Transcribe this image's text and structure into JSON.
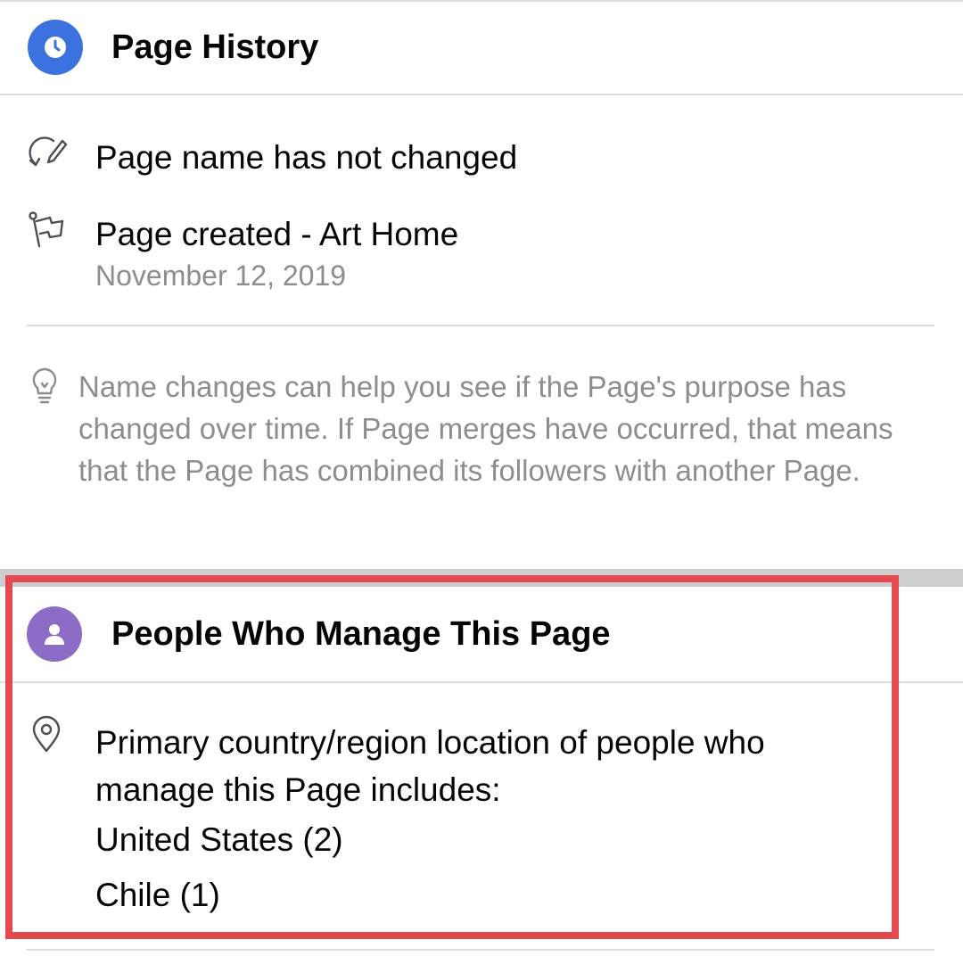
{
  "page_history": {
    "title": "Page History",
    "icon": "clock-icon",
    "icon_color": "#3b72e0",
    "rows": [
      {
        "icon": "edit-history-icon",
        "text": "Page name has not changed"
      },
      {
        "icon": "flag-icon",
        "text": "Page created - Art Home",
        "subtext": "November 12, 2019"
      }
    ],
    "tip": {
      "icon": "lightbulb-icon",
      "text": "Name changes can help you see if the Page's purpose has changed over time. If Page merges have occurred, that means that the Page has combined its followers with another Page."
    }
  },
  "managers": {
    "title": "People Who Manage This Page",
    "icon": "person-icon",
    "icon_color": "#8c6cc7",
    "location": {
      "icon": "location-pin-icon",
      "line1": "Primary country/region location of people who",
      "line2": "manage this Page includes:",
      "countries": [
        "United States (2)",
        "Chile (1)"
      ]
    },
    "highlight_color": "#e5484d"
  }
}
